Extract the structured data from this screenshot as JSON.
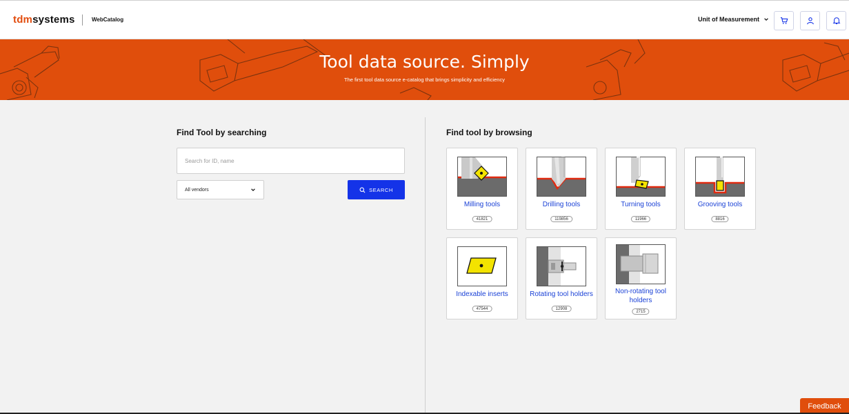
{
  "header": {
    "logo_prefix": "tdm",
    "logo_suffix": "systems",
    "app_name": "WebCatalog",
    "unit_label": "Unit of Measurement",
    "cart_icon": "cart-icon",
    "user_icon": "user-icon",
    "bell_icon": "bell-icon"
  },
  "banner": {
    "title": "Tool data source. Simply",
    "subtitle": "The first tool data source e-catalog that brings simplicity and efficiency"
  },
  "search": {
    "title": "Find Tool by searching",
    "placeholder": "Search for ID, name",
    "vendor_selected": "All vendors",
    "button_label": "SEARCH"
  },
  "browse": {
    "title": "Find tool by browsing",
    "tools": [
      {
        "label": "Milling tools",
        "count": "41821"
      },
      {
        "label": "Drilling tools",
        "count": "119856"
      },
      {
        "label": "Turning tools",
        "count": "11966"
      },
      {
        "label": "Grooving tools",
        "count": "8816"
      },
      {
        "label": "Indexable inserts",
        "count": "47544"
      },
      {
        "label": "Rotating tool holders",
        "count": "12908"
      },
      {
        "label": "Non-rotating tool holders",
        "count": "2715"
      }
    ]
  },
  "feedback_label": "Feedback",
  "colors": {
    "brand": "#e04e0c",
    "accent": "#1433e8",
    "link": "#1a41d6"
  }
}
